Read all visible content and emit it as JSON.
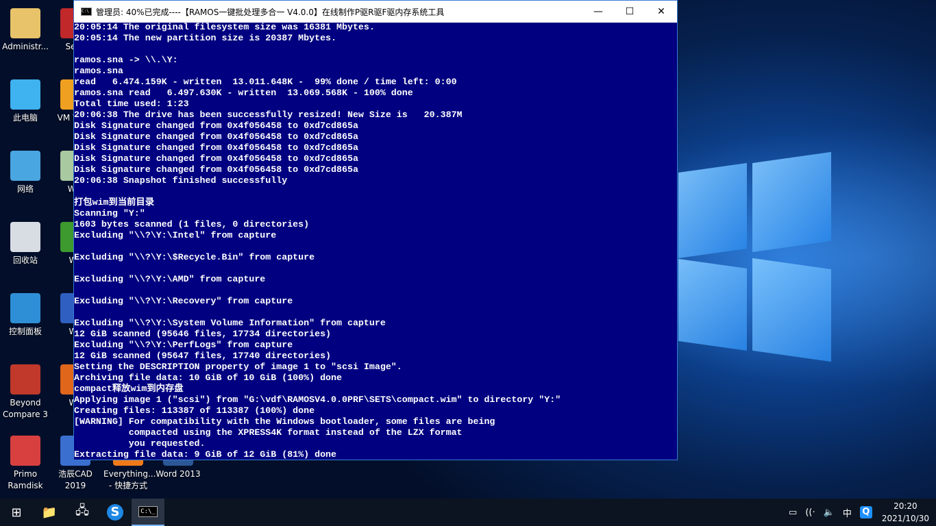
{
  "desktop": {
    "col1": [
      {
        "label": "Administr...",
        "icon": "user-folder-icon",
        "color": "#e8c36a"
      },
      {
        "label": "此电脑",
        "icon": "computer-icon",
        "color": "#3fb2f0"
      },
      {
        "label": "网络",
        "icon": "network-icon",
        "color": "#4aa6e0"
      },
      {
        "label": "回收站",
        "icon": "recycle-bin-icon",
        "color": "#d8dde4"
      },
      {
        "label": "控制面板",
        "icon": "control-panel-icon",
        "color": "#2f8fd6"
      },
      {
        "label": "Beyond Compare 3",
        "icon": "beyond-compare-icon",
        "color": "#c0392b"
      },
      {
        "label": "Primo Ramdisk",
        "icon": "primo-ramdisk-icon",
        "color": "#d84040"
      }
    ],
    "col2": [
      {
        "label": "Seco",
        "icon": "security-shield-icon",
        "color": "#c0282a"
      },
      {
        "label": "VM Work",
        "icon": "vmware-icon",
        "color": "#f0a020"
      },
      {
        "label": "Win",
        "icon": "winhex-icon",
        "color": "#a9c9a0"
      },
      {
        "label": "WP",
        "icon": "wps-spreadsheet-icon",
        "color": "#3c9a2e"
      },
      {
        "label": "WP",
        "icon": "wps-writer-icon",
        "color": "#2f5fc0"
      },
      {
        "label": "WP",
        "icon": "wps-presentation-icon",
        "color": "#e0661c"
      },
      {
        "label": "浩辰CAD 2019",
        "icon": "gstarcad-icon",
        "color": "#3a6fd0"
      }
    ],
    "bottom": [
      {
        "label": "Everything... - 快捷方式",
        "icon": "everything-icon",
        "color": "#f07a1a"
      },
      {
        "label": "Word 2013",
        "icon": "word-icon",
        "color": "#2b5797"
      }
    ]
  },
  "window": {
    "title": "管理员:  40%已完成----【RAMOS一键批处理多合一 V4.0.0】在线制作P驱R驱F驱内存系统工具",
    "minimize": "—",
    "maximize": "☐",
    "close": "✕",
    "lines": [
      "20:05:14 The original filesystem size was 16381 Mbytes.",
      "20:05:14 The new partition size is 20387 Mbytes.",
      "",
      "ramos.sna -> \\\\.\\Y:",
      "ramos.sna",
      "read   6.474.159K - written  13.011.648K -  99% done / time left: 0:00",
      "ramos.sna read   6.497.630K - written  13.069.568K - 100% done",
      "Total time used: 1:23",
      "20:06:38 The drive has been successfully resized! New Size is   20.387M",
      "Disk Signature changed from 0x4f056458 to 0xd7cd865a",
      "Disk Signature changed from 0x4f056458 to 0xd7cd865a",
      "Disk Signature changed from 0x4f056458 to 0xd7cd865a",
      "Disk Signature changed from 0x4f056458 to 0xd7cd865a",
      "Disk Signature changed from 0x4f056458 to 0xd7cd865a",
      "20:06:38 Snapshot finished successfully",
      "",
      "打包wim到当前目录",
      "Scanning \"Y:\"",
      "1603 bytes scanned (1 files, 0 directories)",
      "Excluding \"\\\\?\\Y:\\Intel\" from capture",
      "",
      "Excluding \"\\\\?\\Y:\\$Recycle.Bin\" from capture",
      "",
      "Excluding \"\\\\?\\Y:\\AMD\" from capture",
      "",
      "Excluding \"\\\\?\\Y:\\Recovery\" from capture",
      "",
      "Excluding \"\\\\?\\Y:\\System Volume Information\" from capture",
      "12 GiB scanned (95646 files, 17734 directories)",
      "Excluding \"\\\\?\\Y:\\PerfLogs\" from capture",
      "12 GiB scanned (95647 files, 17740 directories)",
      "Setting the DESCRIPTION property of image 1 to \"scsi Image\".",
      "Archiving file data: 10 GiB of 10 GiB (100%) done",
      "compact释放wim到内存盘",
      "Applying image 1 (\"scsi\") from \"G:\\vdf\\RAMOSV4.0.0PRF\\SETS\\compact.wim\" to directory \"Y:\"",
      "Creating files: 113387 of 113387 (100%) done",
      "[WARNING] For compatibility with the Windows bootloader, some files are being",
      "          compacted using the XPRESS4K format instead of the LZX format",
      "          you requested.",
      "Extracting file data: 9 GiB of 12 GiB (81%) done"
    ]
  },
  "taskbar": {
    "items": [
      {
        "name": "start-button",
        "icon": "windows-logo-icon",
        "glyph": "⊞"
      },
      {
        "name": "file-explorer-button",
        "icon": "folder-icon",
        "glyph": "📁"
      },
      {
        "name": "network-tool-button",
        "icon": "network-monitor-icon",
        "glyph": "🖧"
      },
      {
        "name": "sogou-browser-button",
        "icon": "sogou-icon",
        "glyph": "S"
      },
      {
        "name": "cmd-button",
        "icon": "cmd-icon",
        "glyph": "C:\\_",
        "active": true
      }
    ],
    "tray": {
      "ime": "中",
      "time": "20:20",
      "date": "2021/10/30"
    }
  }
}
